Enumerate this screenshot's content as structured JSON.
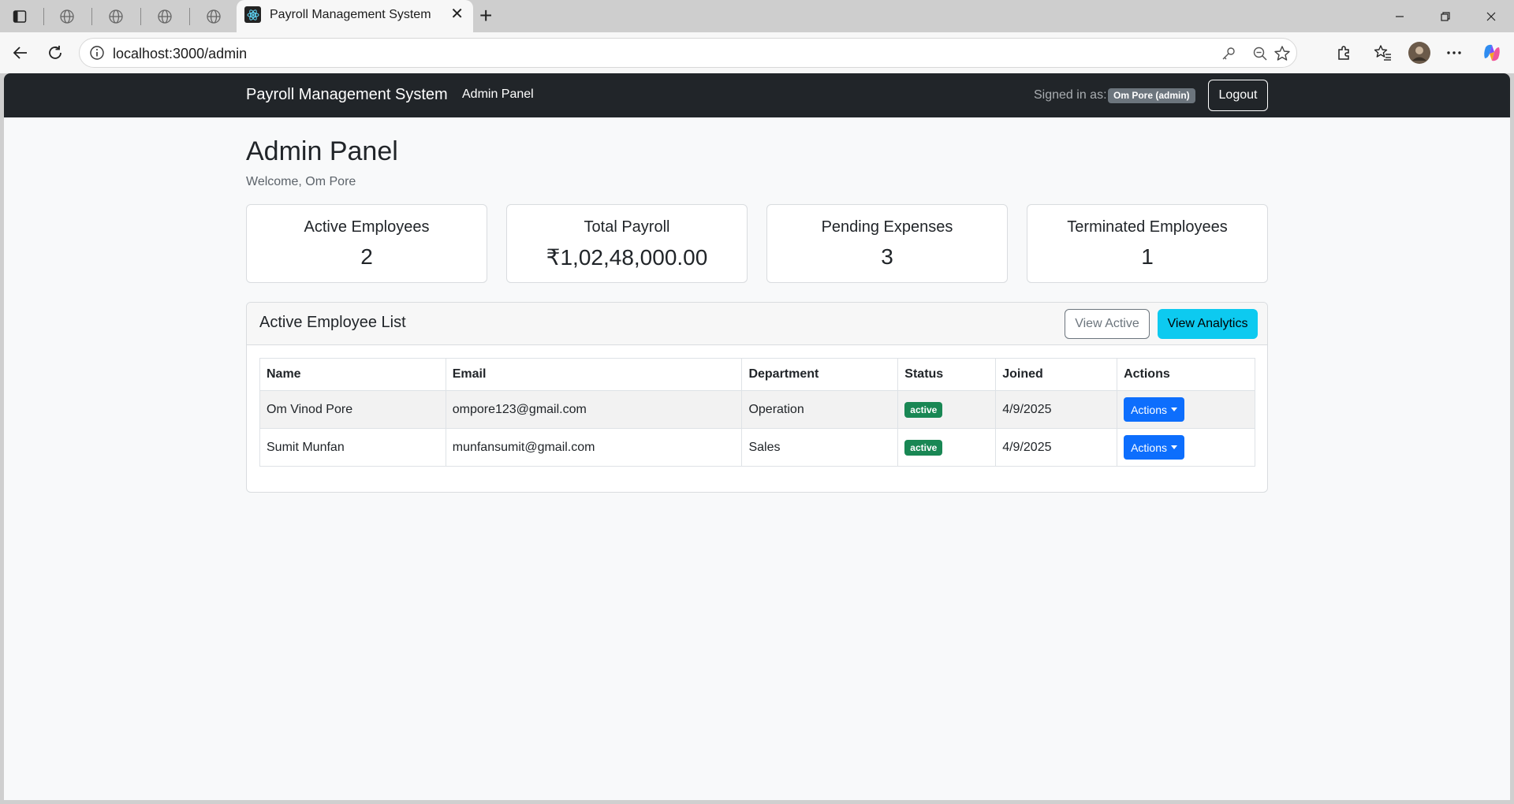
{
  "browser": {
    "tab_title": "Payroll Management System",
    "url": "localhost:3000/admin"
  },
  "navbar": {
    "brand": "Payroll Management System",
    "link": "Admin Panel",
    "signed_in_label": "Signed in as:",
    "user_badge": "Om Pore (admin)",
    "logout_label": "Logout"
  },
  "page": {
    "title": "Admin Panel",
    "welcome": "Welcome, Om Pore"
  },
  "stats": [
    {
      "label": "Active Employees",
      "value": "2"
    },
    {
      "label": "Total Payroll",
      "value": "₹1,02,48,000.00"
    },
    {
      "label": "Pending Expenses",
      "value": "3"
    },
    {
      "label": "Terminated Employees",
      "value": "1"
    }
  ],
  "employee_list": {
    "title": "Active Employee List",
    "view_active_label": "View Active",
    "view_analytics_label": "View Analytics",
    "columns": [
      "Name",
      "Email",
      "Department",
      "Status",
      "Joined",
      "Actions"
    ],
    "rows": [
      {
        "name": "Om Vinod Pore",
        "email": "ompore123@gmail.com",
        "department": "Operation",
        "status": "active",
        "joined": "4/9/2025",
        "action": "Actions"
      },
      {
        "name": "Sumit Munfan",
        "email": "munfansumit@gmail.com",
        "department": "Sales",
        "status": "active",
        "joined": "4/9/2025",
        "action": "Actions"
      }
    ]
  },
  "colors": {
    "navbar_bg": "#212529",
    "info_button": "#0dcaf0",
    "primary_button": "#0d6efd",
    "success_badge": "#198754",
    "secondary_badge": "#6c757d"
  }
}
